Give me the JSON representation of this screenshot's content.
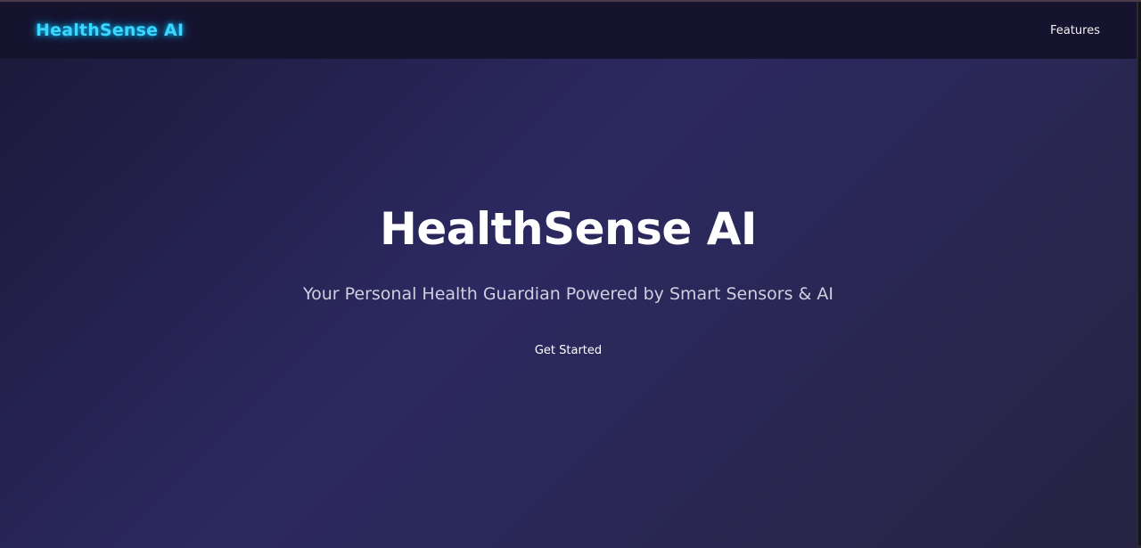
{
  "navbar": {
    "brand": "HealthSense AI",
    "links": [
      {
        "label": "Features"
      }
    ]
  },
  "hero": {
    "title": "HealthSense AI",
    "subtitle": "Your Personal Health Guardian Powered by Smart Sensors & AI",
    "cta_label": "Get Started"
  },
  "colors": {
    "brand_glow": "#3cd6ff",
    "navbar_bg": "#16132f",
    "hero_bg_mid": "#2c2961",
    "text_primary": "#ffffff",
    "text_secondary": "#cfcfe0"
  }
}
